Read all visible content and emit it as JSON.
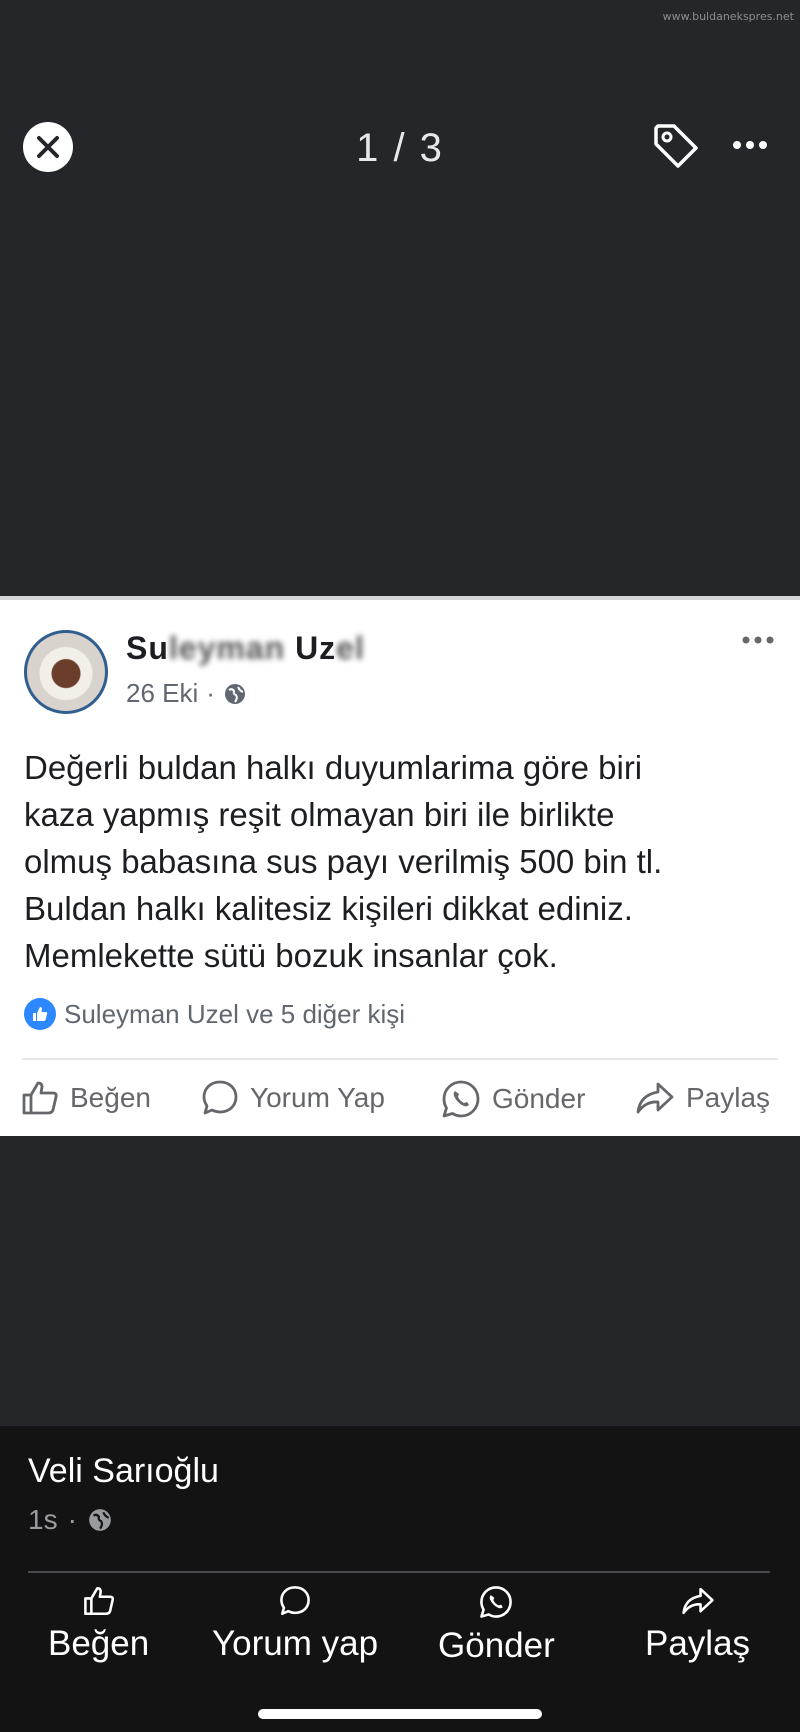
{
  "watermark": "www.buldanekspres.net",
  "viewer": {
    "counter": "1 / 3",
    "icons": {
      "close": "close-icon",
      "tag": "tag-icon",
      "more": "more-icon"
    }
  },
  "post_screenshot": {
    "author": {
      "name_visible_start": "Su",
      "name_blurred_middle": "leyman",
      "name_visible_end": "Uz",
      "name_blurred_end": "el"
    },
    "date": "26 Eki",
    "privacy_icon": "globe-icon",
    "text_lines": [
      "Değerli buldan halkı duyumlarima göre biri",
      "kaza yapmış reşit olmayan biri ile birlikte",
      "olmuş babasına sus payı verilmiş 500 bin tl.",
      "Buldan halkı kalitesiz kişileri dikkat ediniz.",
      "Memlekette sütü bozuk insanlar çok."
    ],
    "reactions": "Suleyman Uzel ve 5 diğer kişi",
    "actions": {
      "like": "Beğen",
      "comment": "Yorum Yap",
      "send": "Gönder",
      "share": "Paylaş"
    }
  },
  "caption": {
    "poster_name": "Veli Sarıoğlu",
    "time": "1s",
    "privacy_icon": "globe-icon"
  },
  "bottom_actions": {
    "like": "Beğen",
    "comment": "Yorum yap",
    "send": "Gönder",
    "share": "Paylaş"
  },
  "colors": {
    "background": "#25262a",
    "card": "#ffffff",
    "bottom_panel": "#131314",
    "like_blue": "#2d88ff"
  }
}
